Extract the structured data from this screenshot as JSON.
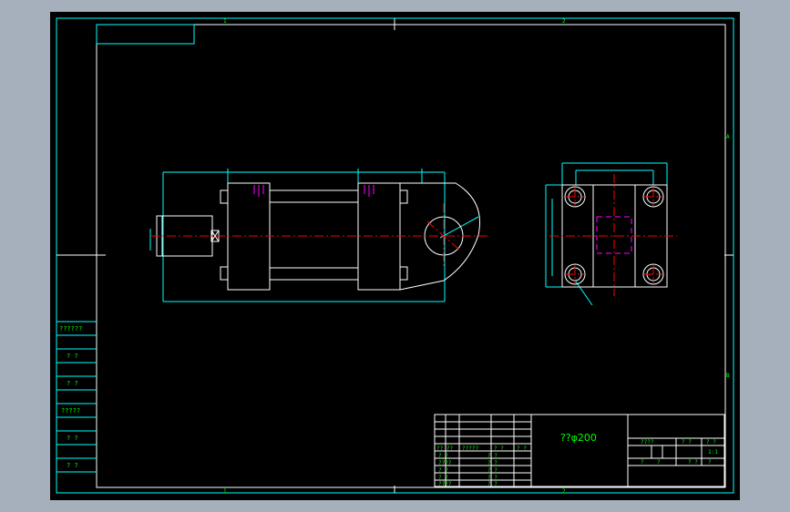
{
  "drawing": {
    "title": "??φ200",
    "zone_marks": {
      "top_1": "1",
      "top_2": "2",
      "bottom_1": "1",
      "bottom_2": "2",
      "right_a": "A",
      "right_b": "B"
    },
    "left_column_labels": [
      "??????",
      "? ?",
      "? ?",
      "?????",
      "? ?",
      "? ?"
    ],
    "title_block": {
      "row_labels": [
        "?? ??",
        "?????",
        "? ?",
        "? ?"
      ],
      "sign_labels": [
        "? ?",
        "? ?",
        "????",
        "? ?",
        "? ?",
        "? ?",
        "? ?",
        "????",
        "? ?",
        "? ?"
      ],
      "right_labels": {
        "r1_a": "????",
        "r1_b": "? ?",
        "r1_c": "? ?",
        "scale": "1:1",
        "r3_a": "?",
        "r3_b": "?",
        "r3_c": "? ?",
        "r3_d": "?"
      }
    }
  },
  "colors": {
    "background": "#a5b0bc",
    "sheet": "#000000",
    "frame": "#00ffff",
    "outline": "#ffffff",
    "centerline": "#ff0000",
    "dimension": "#00ffff",
    "hidden": "#ff00ff",
    "text": "#00ff00"
  }
}
